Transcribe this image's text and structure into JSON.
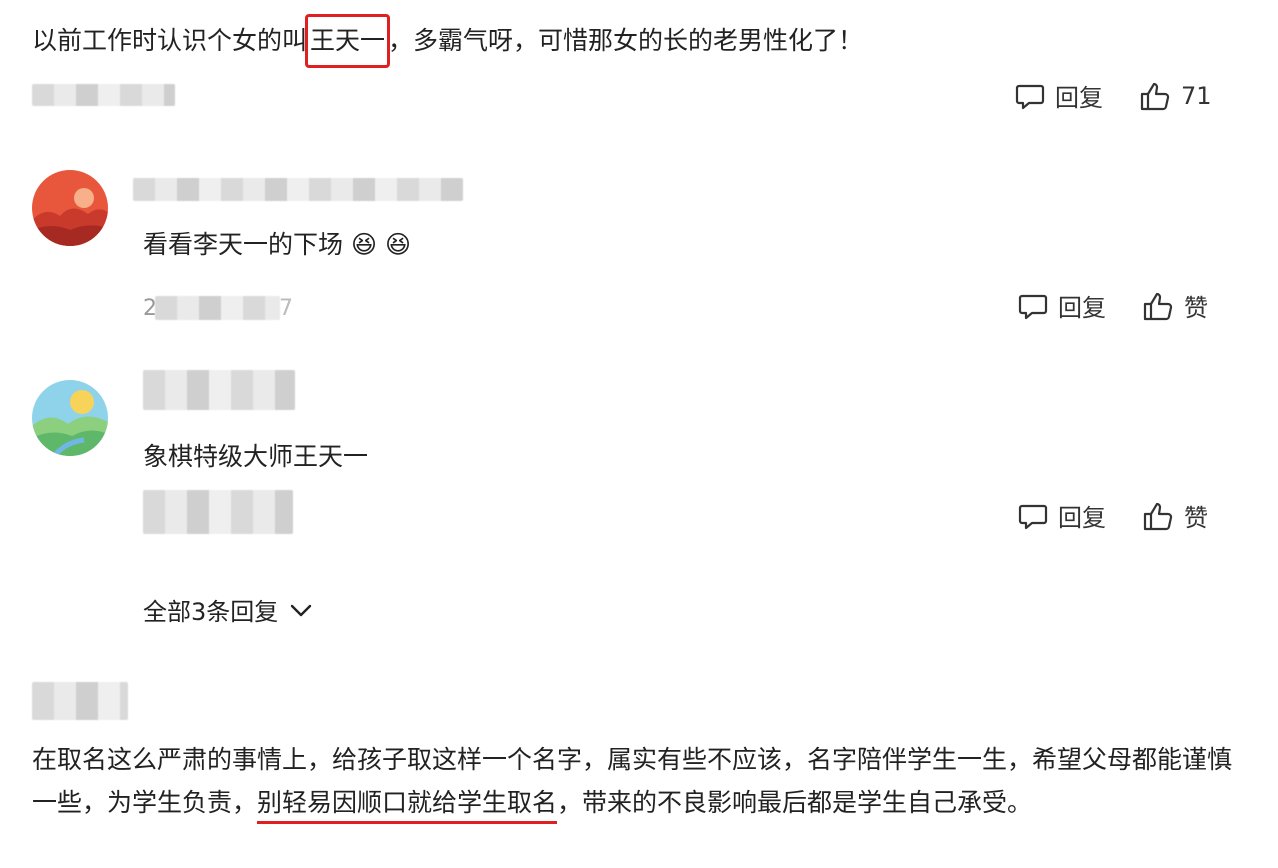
{
  "top_comment": {
    "text_before": "以前工作时认识个女的叫",
    "highlight": "王天一",
    "text_after": "，多霸气呀，可惜那女的长的老男性化了！",
    "reply_label": "回复",
    "like_count": "71"
  },
  "replies": [
    {
      "text": "看看李天一的下场",
      "emoji": [
        "😆",
        "😆"
      ],
      "date_fragment_start": "2",
      "date_fragment_end": "7",
      "reply_label": "回复",
      "like_label": "赞"
    },
    {
      "text": "象棋特级大师王天一",
      "reply_label": "回复",
      "like_label": "赞"
    }
  ],
  "expand_replies_label": "全部3条回复",
  "bottom_comment": {
    "text_before": "在取名这么严肃的事情上，给孩子取这样一个名字，属实有些不应该，名字陪伴学生一生，希望父母都能谨慎一些，为学生负责，",
    "text_underlined": "别轻易因顺口就给学生取名",
    "text_after": "，带来的不良影响最后都是学生自己承受。"
  },
  "colors": {
    "highlight_red": "#e02020",
    "text": "#222222",
    "avatar1": "#e8573b",
    "avatar2": "#6cc7e0"
  }
}
